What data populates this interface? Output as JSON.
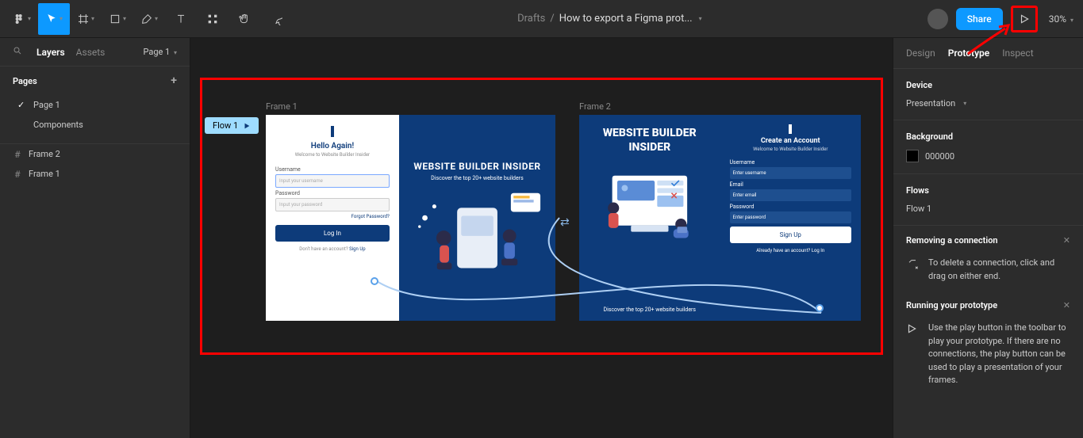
{
  "toolbar": {
    "breadcrumb_parent": "Drafts",
    "breadcrumb_file": "How to export a Figma prot...",
    "share_label": "Share",
    "zoom": "30%"
  },
  "left": {
    "tab_layers": "Layers",
    "tab_assets": "Assets",
    "page_select": "Page 1",
    "pages_label": "Pages",
    "pages": [
      {
        "name": "Page 1",
        "checked": true
      },
      {
        "name": "Components",
        "checked": false
      }
    ],
    "layers": [
      {
        "name": "Frame 2"
      },
      {
        "name": "Frame 1"
      }
    ]
  },
  "canvas": {
    "flow_badge": "Flow 1",
    "frame1_label": "Frame 1",
    "frame2_label": "Frame 2",
    "frame1": {
      "title": "Hello Again!",
      "subtitle": "Welcome to Website Builder Insider",
      "username_label": "Username",
      "username_ph": "Input your username",
      "password_label": "Password",
      "password_ph": "Input your password",
      "forgot": "Forgot Password?",
      "login_btn": "Log In",
      "signup_prompt": "Don't have an account? ",
      "signup_link": "Sign Up",
      "hero_title": "WEBSITE BUILDER INSIDER",
      "hero_sub": "Discover the top 20+ website builders"
    },
    "frame2": {
      "hero_title": "WEBSITE BUILDER INSIDER",
      "hero_sub": "Discover the top 20+ website builders",
      "title": "Create an Account",
      "subtitle": "Welcome to Website Builder Insider",
      "username_label": "Username",
      "username_ph": "Enter username",
      "email_label": "Email",
      "email_ph": "Enter email",
      "password_label": "Password",
      "password_ph": "Enter password",
      "signup_btn": "Sign Up",
      "login_prompt": "Already have an account? ",
      "login_link": "Log In"
    }
  },
  "right": {
    "tab_design": "Design",
    "tab_prototype": "Prototype",
    "tab_inspect": "Inspect",
    "device_label": "Device",
    "device_value": "Presentation",
    "background_label": "Background",
    "background_value": "000000",
    "flows_label": "Flows",
    "flows_value": "Flow 1",
    "removing_title": "Removing a connection",
    "removing_text": "To delete a connection, click and drag on either end.",
    "running_title": "Running your prototype",
    "running_text": "Use the play button in the toolbar to play your prototype. If there are no connections, the play button can be used to play a presentation of your frames."
  }
}
